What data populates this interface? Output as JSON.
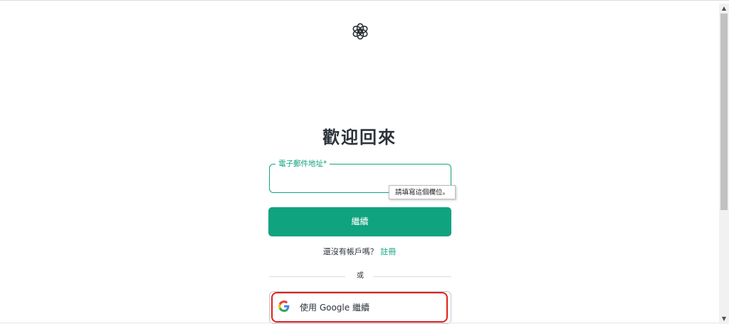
{
  "login": {
    "title": "歡迎回來",
    "email_label": "電子郵件地址*",
    "email_value": "",
    "validation_tooltip": "請填寫這個欄位。",
    "continue_label": "繼續",
    "signup_prompt": "還沒有帳戶嗎？",
    "signup_link": "註冊",
    "divider_text": "或",
    "google_label": "使用 Google 繼續"
  },
  "icons": {
    "logo": "openai-logo-icon",
    "google": "google-g-icon",
    "scroll_up": "scroll-up-arrow-icon",
    "scroll_down": "scroll-down-arrow-icon"
  },
  "colors": {
    "accent": "#10a37f",
    "text": "#2d333a",
    "highlight": "#e0211d",
    "border": "#c2c8d0"
  }
}
